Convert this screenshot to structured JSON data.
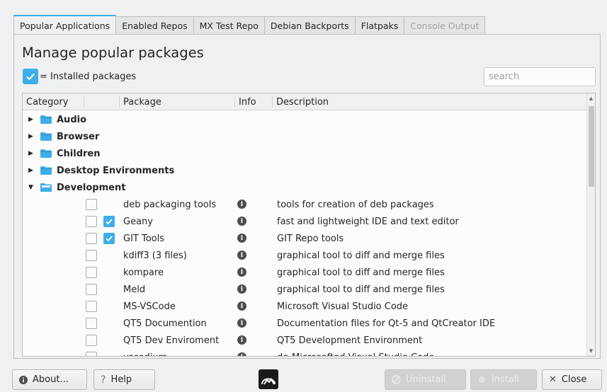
{
  "tabs": [
    {
      "label": "Popular Applications",
      "state": "active"
    },
    {
      "label": "Enabled Repos",
      "state": "normal"
    },
    {
      "label": "MX Test Repo",
      "state": "normal"
    },
    {
      "label": "Debian Backports",
      "state": "normal"
    },
    {
      "label": "Flatpaks",
      "state": "normal"
    },
    {
      "label": "Console Output",
      "state": "disabled"
    }
  ],
  "heading": "Manage popular packages",
  "legend": {
    "text": "= Installed packages"
  },
  "search": {
    "placeholder": "search",
    "value": ""
  },
  "columns": {
    "category": "Category",
    "package": "Package",
    "info": "Info",
    "description": "Description"
  },
  "categories": [
    {
      "label": "Audio",
      "expanded": false
    },
    {
      "label": "Browser",
      "expanded": false
    },
    {
      "label": "Children",
      "expanded": false
    },
    {
      "label": "Desktop Environments",
      "expanded": false
    },
    {
      "label": "Development",
      "expanded": true
    }
  ],
  "packages": [
    {
      "name": "deb packaging tools",
      "installed": false,
      "description": "tools for creation of deb packages"
    },
    {
      "name": "Geany",
      "installed": true,
      "description": "fast and lightweight IDE and text editor"
    },
    {
      "name": "GIT Tools",
      "installed": true,
      "description": "GIT Repo tools"
    },
    {
      "name": "kdiff3 (3 files)",
      "installed": false,
      "description": "graphical tool to diff and merge files"
    },
    {
      "name": "kompare",
      "installed": false,
      "description": "graphical tool to diff and merge files"
    },
    {
      "name": "Meld",
      "installed": false,
      "description": "graphical tool to diff and merge files"
    },
    {
      "name": "MS-VSCode",
      "installed": false,
      "description": "Microsoft Visual Studio Code"
    },
    {
      "name": "QT5 Documention",
      "installed": false,
      "description": "Documentation files for Qt-5 and QtCreator IDE"
    },
    {
      "name": "QT5 Dev Enviroment",
      "installed": false,
      "description": "QT5 Development Environment"
    },
    {
      "name": "vscodium",
      "installed": false,
      "description": "de-Microsofted Visual Studio Code"
    }
  ],
  "buttons": {
    "about": "About...",
    "help": "Help",
    "uninstall": "Uninstall",
    "install": "Install",
    "close": "Close"
  },
  "colors": {
    "accent": "#3daee9",
    "folder": "#3daee9"
  }
}
